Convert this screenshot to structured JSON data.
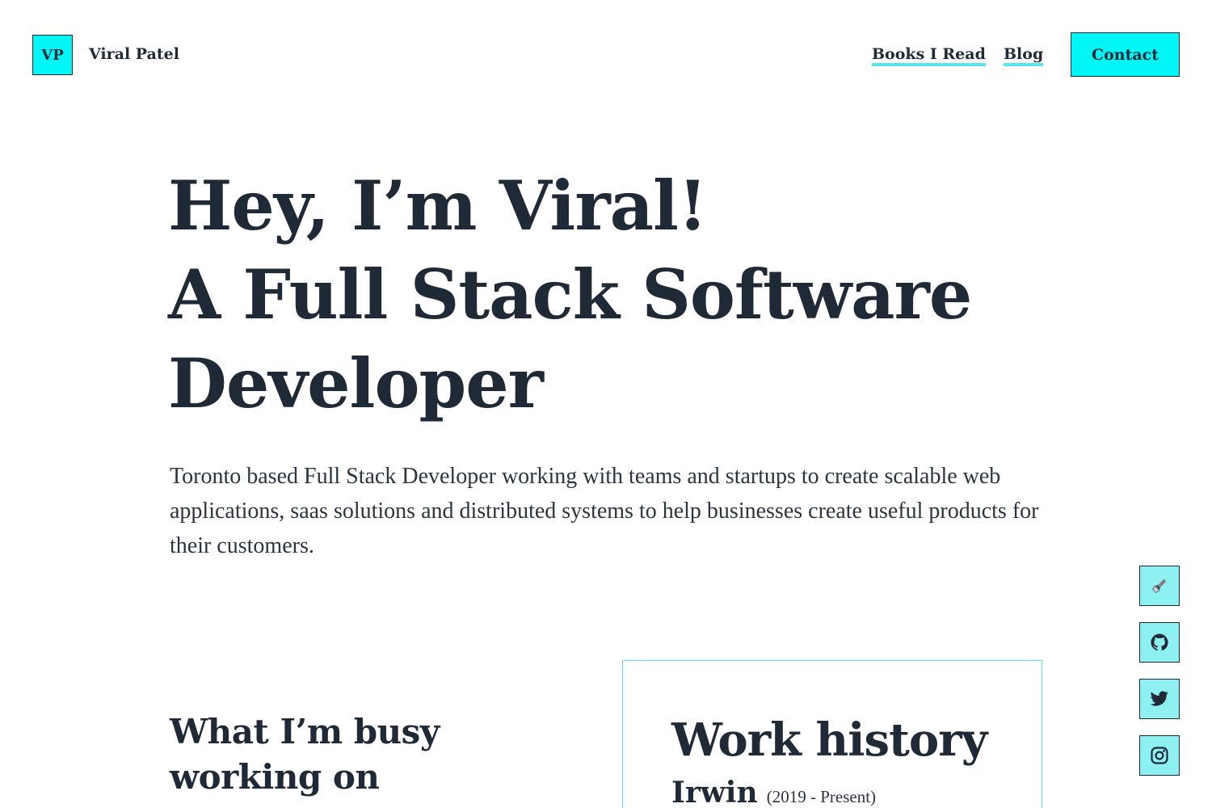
{
  "header": {
    "logo_text": "VP",
    "brand_name": "Viral Patel",
    "nav": {
      "books_label": "Books I Read",
      "blog_label": "Blog",
      "contact_label": "Contact"
    },
    "accent_color": "#00f5f5",
    "underline_color": "#5ee3ea"
  },
  "hero": {
    "title_line1": "Hey, I’m Viral!",
    "title_line2": "A Full Stack Software",
    "title_line3": "Developer",
    "description": "Toronto based Full Stack Developer working with teams and startups to create scalable web applications, saas solutions and distributed systems to help businesses create useful products for their customers."
  },
  "sections": {
    "busy_heading": "What I’m busy working on",
    "work_history": {
      "title": "Work history",
      "jobs": [
        {
          "company": "Irwin",
          "period": "(2019 - Present)"
        }
      ]
    }
  },
  "social": {
    "icons": [
      "flashlight-icon",
      "github-icon",
      "twitter-icon",
      "instagram-icon"
    ],
    "button_color": "#8ef0f0"
  },
  "text_color": "#1f2a36"
}
